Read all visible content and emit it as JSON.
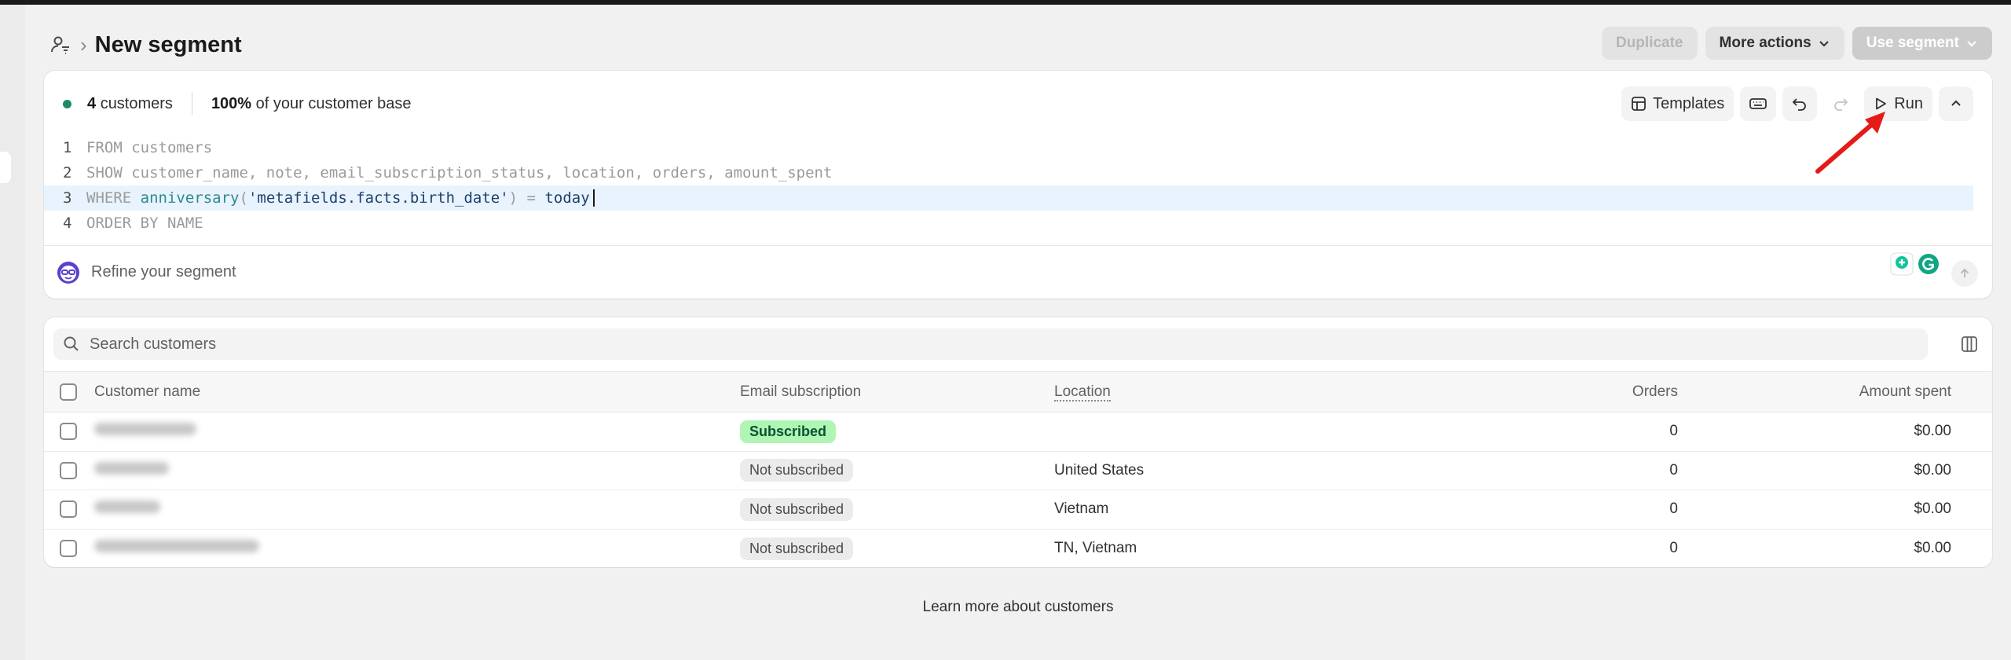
{
  "header": {
    "title": "New segment",
    "actions": {
      "duplicate": "Duplicate",
      "more_actions": "More actions",
      "use_segment": "Use segment"
    }
  },
  "editor": {
    "stats": {
      "customer_count": "4",
      "customer_word": "customers",
      "percent": "100%",
      "percent_suffix": "of your customer base"
    },
    "toolbar": {
      "templates": "Templates",
      "run": "Run"
    },
    "lines": [
      {
        "no": "1",
        "parts": [
          {
            "t": "FROM customers",
            "c": "kw"
          }
        ]
      },
      {
        "no": "2",
        "parts": [
          {
            "t": "SHOW customer_name, note, email_subscription_status, location, orders, amount_spent",
            "c": "kw"
          }
        ]
      },
      {
        "no": "3",
        "parts": [
          {
            "t": "WHERE ",
            "c": "kw"
          },
          {
            "t": "anniversary",
            "c": "fn"
          },
          {
            "t": "(",
            "c": "kw"
          },
          {
            "t": "'metafields.facts.birth_date'",
            "c": "str"
          },
          {
            "t": ") = ",
            "c": "kw"
          },
          {
            "t": "today",
            "c": "plain"
          }
        ]
      },
      {
        "no": "4",
        "parts": [
          {
            "t": "ORDER BY NAME",
            "c": "kw"
          }
        ]
      }
    ],
    "refine_placeholder": "Refine your segment"
  },
  "results": {
    "search_placeholder": "Search customers",
    "columns": {
      "name": "Customer name",
      "email": "Email subscription",
      "location": "Location",
      "orders": "Orders",
      "amount": "Amount spent"
    },
    "rows": [
      {
        "name_blur_width": 0.62,
        "email": "Subscribed",
        "email_status": "subscribed",
        "location": "",
        "orders": "0",
        "amount": "$0.00"
      },
      {
        "name_blur_width": 0.45,
        "email": "Not subscribed",
        "email_status": "not_subscribed",
        "location": "United States",
        "orders": "0",
        "amount": "$0.00"
      },
      {
        "name_blur_width": 0.4,
        "email": "Not subscribed",
        "email_status": "not_subscribed",
        "location": "Vietnam",
        "orders": "0",
        "amount": "$0.00"
      },
      {
        "name_blur_width": 1.0,
        "email": "Not subscribed",
        "email_status": "not_subscribed",
        "location": "TN, Vietnam",
        "orders": "0",
        "amount": "$0.00"
      }
    ]
  },
  "footer": {
    "learn_more": "Learn more about customers"
  },
  "colors": {
    "accent_green": "#1f8a66",
    "subscribed_bg": "#aff5b4",
    "annotation_red": "#e41b17"
  }
}
